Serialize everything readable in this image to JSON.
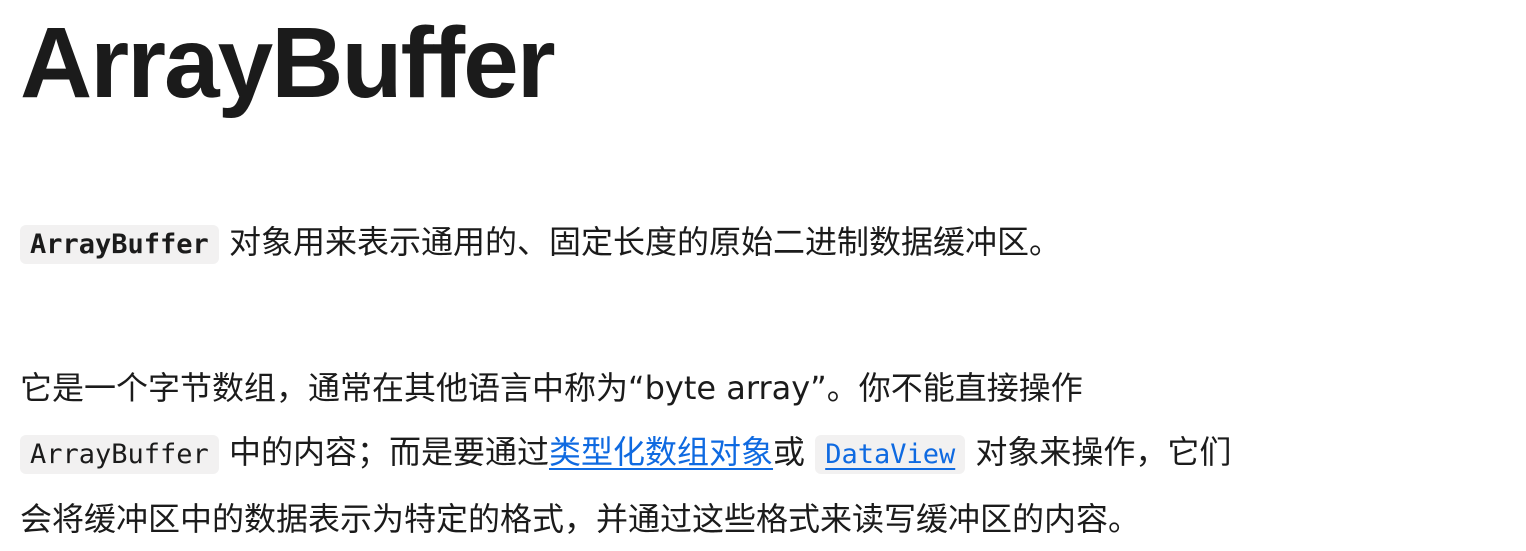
{
  "title": "ArrayBuffer",
  "paragraph1": {
    "code": "ArrayBuffer",
    "text": " 对象用来表示通用的、固定长度的原始二进制数据缓冲区。"
  },
  "paragraph2": {
    "line1": "它是一个字节数组，通常在其他语言中称为“byte array”。你不能直接操作",
    "code1": "ArrayBuffer",
    "text_a": " 中的内容；而是要通过",
    "link1": "类型化数组对象",
    "text_b": "或 ",
    "link2": "DataView",
    "text_c": " 对象来操作，它们",
    "line3": "会将缓冲区中的数据表示为特定的格式，并通过这些格式来读写缓冲区的内容。"
  },
  "colors": {
    "text": "#1b1b1b",
    "link": "#0f6ae1",
    "code_background": "#f2f1f1"
  }
}
